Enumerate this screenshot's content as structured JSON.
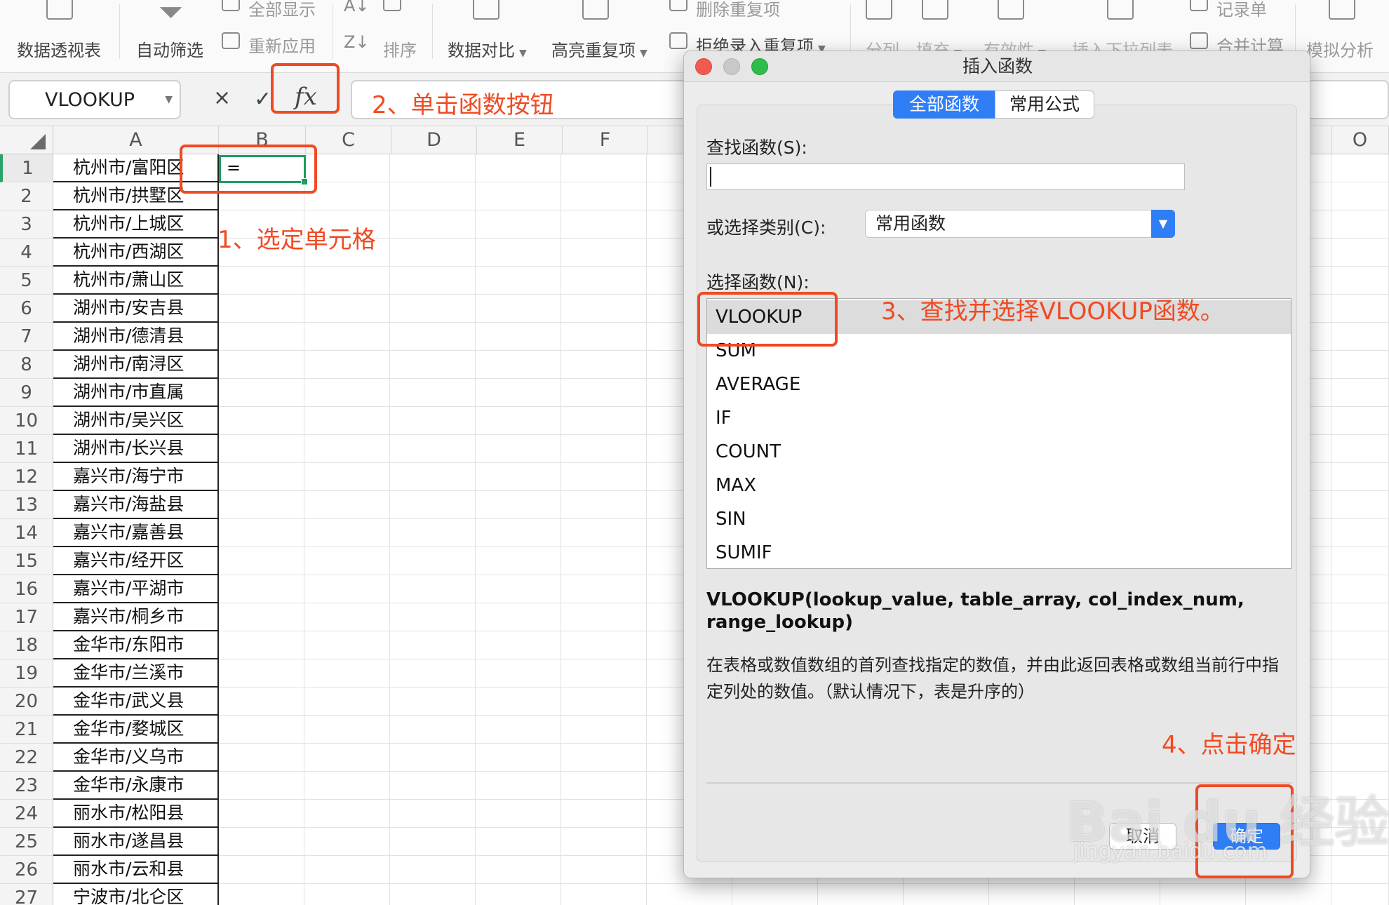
{
  "ribbon": {
    "pivot_table": "数据透视表",
    "auto_filter": "自动筛选",
    "show_all": "全部显示",
    "reapply": "重新应用",
    "sort": "排序",
    "data_compare": "数据对比",
    "highlight_duplicates": "高亮重复项",
    "delete_duplicates": "删除重复项",
    "reject_duplicates": "拒绝录入重复项",
    "split_column": "分列",
    "fill": "填充",
    "validity": "有效性",
    "insert_dropdown": "插入下拉列表",
    "record_form": "记录单",
    "merge_calc": "合并计算",
    "what_if": "模拟分析"
  },
  "formula_bar": {
    "name_box": "VLOOKUP",
    "cancel_symbol": "×",
    "confirm_symbol": "✓",
    "fx_label": "fx"
  },
  "sheet": {
    "columns": [
      "A",
      "B",
      "C",
      "D",
      "E",
      "F",
      "O"
    ],
    "rows": [
      {
        "n": "1",
        "a": "杭州市/富阳区"
      },
      {
        "n": "2",
        "a": "杭州市/拱墅区"
      },
      {
        "n": "3",
        "a": "杭州市/上城区"
      },
      {
        "n": "4",
        "a": "杭州市/西湖区"
      },
      {
        "n": "5",
        "a": "杭州市/萧山区"
      },
      {
        "n": "6",
        "a": "湖州市/安吉县"
      },
      {
        "n": "7",
        "a": "湖州市/德清县"
      },
      {
        "n": "8",
        "a": "湖州市/南浔区"
      },
      {
        "n": "9",
        "a": "湖州市/市直属"
      },
      {
        "n": "10",
        "a": "湖州市/吴兴区"
      },
      {
        "n": "11",
        "a": "湖州市/长兴县"
      },
      {
        "n": "12",
        "a": "嘉兴市/海宁市"
      },
      {
        "n": "13",
        "a": "嘉兴市/海盐县"
      },
      {
        "n": "14",
        "a": "嘉兴市/嘉善县"
      },
      {
        "n": "15",
        "a": "嘉兴市/经开区"
      },
      {
        "n": "16",
        "a": "嘉兴市/平湖市"
      },
      {
        "n": "17",
        "a": "嘉兴市/桐乡市"
      },
      {
        "n": "18",
        "a": "金华市/东阳市"
      },
      {
        "n": "19",
        "a": "金华市/兰溪市"
      },
      {
        "n": "20",
        "a": "金华市/武义县"
      },
      {
        "n": "21",
        "a": "金华市/婺城区"
      },
      {
        "n": "22",
        "a": "金华市/义乌市"
      },
      {
        "n": "23",
        "a": "金华市/永康市"
      },
      {
        "n": "24",
        "a": "丽水市/松阳县"
      },
      {
        "n": "25",
        "a": "丽水市/遂昌县"
      },
      {
        "n": "26",
        "a": "丽水市/云和县"
      },
      {
        "n": "27",
        "a": "宁波市/北仑区"
      }
    ],
    "active_cell_value": "="
  },
  "annotations": {
    "step1": "1、选定单元格",
    "step2": "2、单击函数按钮",
    "step3": "3、查找并选择VLOOKUP函数。",
    "step4": "4、点击确定"
  },
  "dialog": {
    "title": "插入函数",
    "tab_all": "全部函数",
    "tab_common": "常用公式",
    "search_label": "查找函数(S):",
    "search_value": "",
    "category_label": "或选择类别(C):",
    "category_value": "常用函数",
    "select_label": "选择函数(N):",
    "functions": [
      "VLOOKUP",
      "SUM",
      "AVERAGE",
      "IF",
      "COUNT",
      "MAX",
      "SIN",
      "SUMIF"
    ],
    "selected_function": "VLOOKUP",
    "signature": "VLOOKUP(lookup_value, table_array, col_index_num, range_lookup)",
    "description": "在表格或数值数组的首列查找指定的数值，并由此返回表格或数组当前行中指定列处的数值。（默认情况下，表是升序的）",
    "cancel_label": "取消",
    "ok_label": "确定"
  },
  "watermark": {
    "logo": "Bai du 经验",
    "url": "jingyan.baidu.com"
  },
  "colors": {
    "accent_blue": "#2f7ef6",
    "annotation_red": "#f04a23",
    "active_cell_green": "#1f9d5f",
    "light_red": "#f25a50",
    "light_gray": "#c8c8c8",
    "light_green": "#2ebd4a"
  }
}
